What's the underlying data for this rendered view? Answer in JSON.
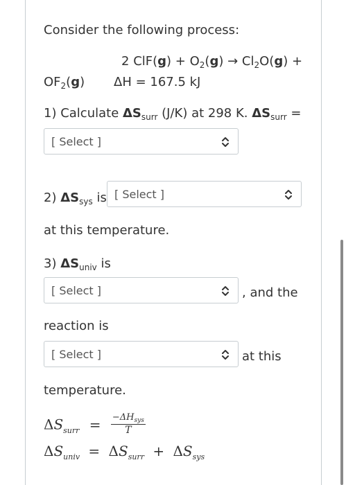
{
  "question": {
    "intro": "Consider the following process:",
    "reaction": {
      "coef": "2 ",
      "r1": "ClF(",
      "r1_state": "g",
      "r1_close": ")",
      "plus1": " + ",
      "r2": "O",
      "r2_sub": "2",
      "r2_open": "(",
      "r2_state": "g",
      "r2_close": ")",
      "arrow": " → ",
      "p1": "Cl",
      "p1_sub": "2",
      "p1_rest": "O(",
      "p1_state": "g",
      "p1_close": ")",
      "plus2": " +",
      "p2": "OF",
      "p2_sub": "2",
      "p2_open": "(",
      "p2_state": "g",
      "p2_close": ")",
      "dh": "ΔH = 167.5 kJ"
    },
    "q1": {
      "pre": "1) Calculate ",
      "delta_s": "ΔS",
      "surr_sub": "surr",
      "mid": " (J/K) at 298 K. ",
      "delta_s2": "ΔS",
      "surr_sub2": "surr",
      "eq": " ="
    },
    "q2": {
      "pre": "2) ",
      "delta_s": "ΔS",
      "sys_sub": "sys",
      "is": " is",
      "after": "at this temperature."
    },
    "q3": {
      "pre": "3) ",
      "delta_s": "ΔS",
      "univ_sub": "univ",
      "is": " is",
      "and_the": ", and the",
      "reaction_is": "reaction is",
      "at_this": "at this",
      "temperature": "temperature."
    },
    "formulas": {
      "delta": "Δ",
      "S": "S",
      "surr": "surr",
      "univ": "univ",
      "sys": "sys",
      "equals": "=",
      "plus": "+",
      "num": "−ΔH",
      "num_sub": "sys",
      "den": "T"
    }
  },
  "selects": {
    "s1": "[ Select ]",
    "s2": "[ Select ]",
    "s3": "[ Select ]",
    "s4": "[ Select ]"
  }
}
